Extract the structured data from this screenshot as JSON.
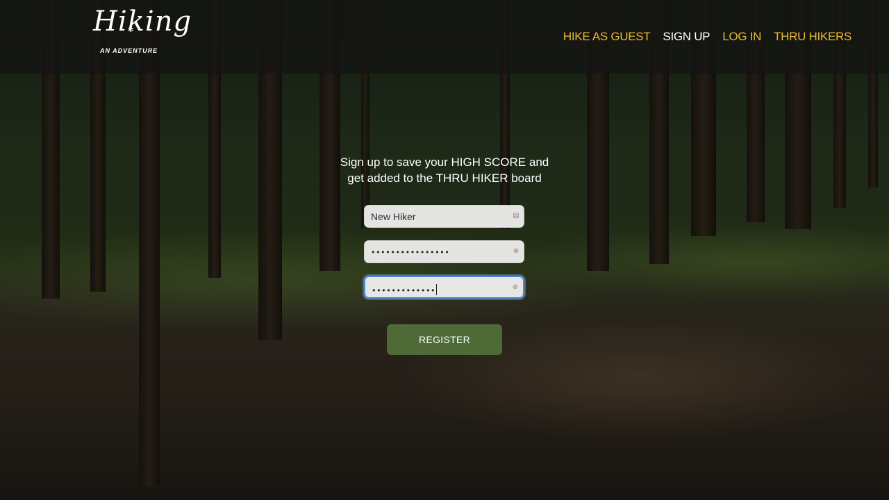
{
  "app": {
    "logo_text": "Hiking",
    "logo_subtext": "AN ADVENTURE"
  },
  "nav": {
    "items": [
      {
        "label": "HIKE AS GUEST",
        "active": false
      },
      {
        "label": "SIGN UP",
        "active": true
      },
      {
        "label": "LOG IN",
        "active": false
      },
      {
        "label": "THRU HIKERS",
        "active": false
      }
    ]
  },
  "form": {
    "headline_line1": "Sign up to save your HIGH SCORE and",
    "headline_line2": "get added to the THRU HIKER board",
    "username_value": "New Hiker",
    "password_mask": "••••••••••••••••",
    "confirm_mask": "•••••••••••••",
    "register_label": "REGISTER"
  },
  "colors": {
    "nav_link": "#e9b933",
    "nav_active": "#ffffff",
    "button_bg": "#4d6a37",
    "focus_ring": "#4c86d9"
  },
  "icons": {
    "username_field": "contact-card-icon",
    "password_field": "key-icon",
    "confirm_field": "key-icon"
  }
}
